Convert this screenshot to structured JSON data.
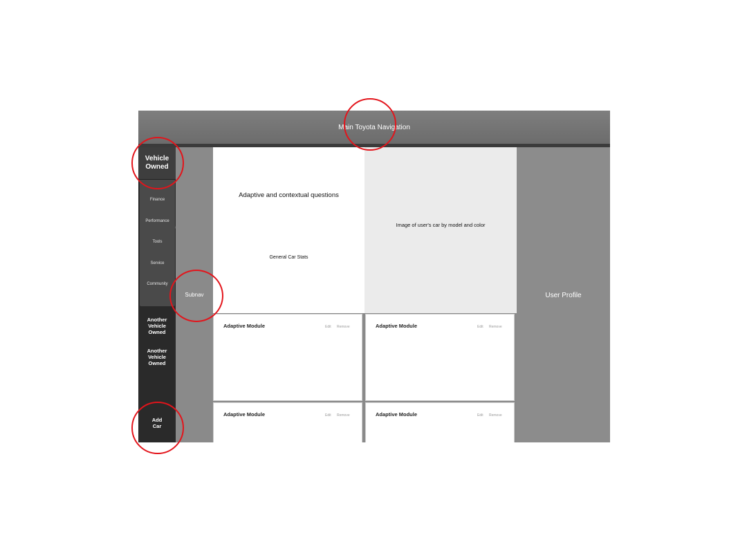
{
  "top_nav": {
    "title": "Main Toyota Navigation"
  },
  "sidebar": {
    "vehicle_owned": "Vehicle Owned",
    "menu": [
      "Finance",
      "Performance",
      "Tools",
      "Service",
      "Community"
    ],
    "other_vehicles": [
      "Another Vehicle Owned",
      "Another Vehicle Owned"
    ],
    "add_car": "Add Car"
  },
  "subnav": {
    "label": "Subnav"
  },
  "questions_panel": {
    "title": "Adaptive and contextual questions",
    "stats": "General Car Stats"
  },
  "car_image": {
    "label": "Image of user's car by model and color"
  },
  "user_profile": {
    "label": "User Profile"
  },
  "modules": [
    {
      "title": "Adaptive Module",
      "edit": "Edit",
      "remove": "Remove"
    },
    {
      "title": "Adaptive Module",
      "edit": "Edit",
      "remove": "Remove"
    },
    {
      "title": "Adaptive Module",
      "edit": "Edit",
      "remove": "Remove"
    },
    {
      "title": "Adaptive Module",
      "edit": "Edit",
      "remove": "Remove"
    }
  ],
  "annotation_color": "#e3141b"
}
